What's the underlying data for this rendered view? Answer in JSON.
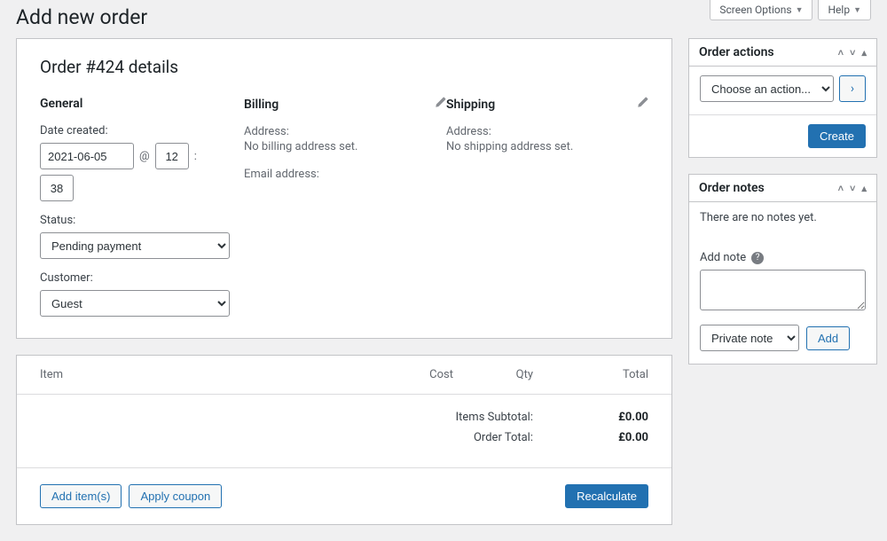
{
  "page": {
    "title": "Add new order"
  },
  "screen_tabs": {
    "options": "Screen Options",
    "help": "Help"
  },
  "details": {
    "heading": "Order #424 details",
    "general_label": "General",
    "date_created_label": "Date created:",
    "date": "2021-06-05",
    "at_symbol": "@",
    "hour": "12",
    "time_sep": ":",
    "minute": "38",
    "status_label": "Status:",
    "status_value": "Pending payment",
    "customer_label": "Customer:",
    "customer_value": "Guest",
    "billing_label": "Billing",
    "billing_address_label": "Address:",
    "billing_address_text": "No billing address set.",
    "billing_email_label": "Email address:",
    "shipping_label": "Shipping",
    "shipping_address_label": "Address:",
    "shipping_address_text": "No shipping address set."
  },
  "items": {
    "col_item": "Item",
    "col_cost": "Cost",
    "col_qty": "Qty",
    "col_total": "Total",
    "subtotal_label": "Items Subtotal:",
    "subtotal_value": "£0.00",
    "order_total_label": "Order Total:",
    "order_total_value": "£0.00",
    "add_items": "Add item(s)",
    "apply_coupon": "Apply coupon",
    "recalculate": "Recalculate"
  },
  "actions_box": {
    "title": "Order actions",
    "select_placeholder": "Choose an action...",
    "create": "Create"
  },
  "notes_box": {
    "title": "Order notes",
    "empty": "There are no notes yet.",
    "add_label": "Add note",
    "type_value": "Private note",
    "add_button": "Add"
  }
}
